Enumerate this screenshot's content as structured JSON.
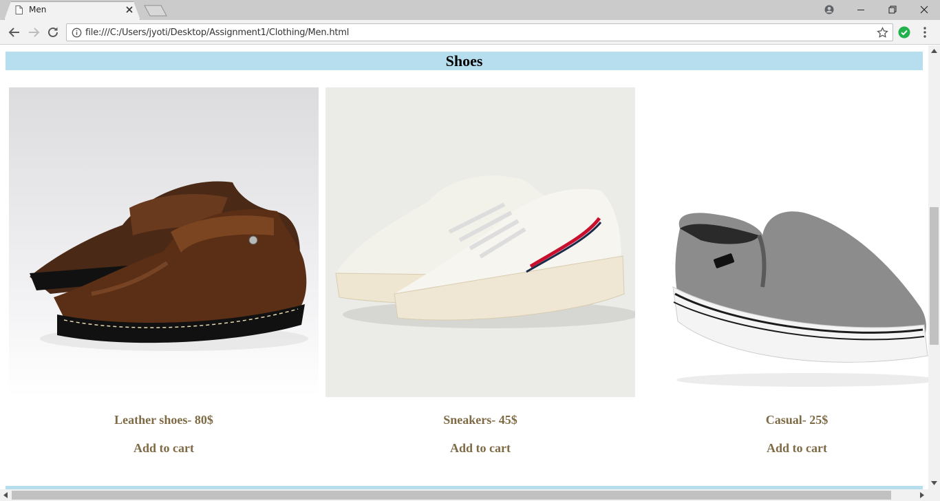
{
  "browser": {
    "tab_title": "Men",
    "url": "file:///C:/Users/jyoti/Desktop/Assignment1/Clothing/Men.html"
  },
  "page": {
    "section_title": "Shoes",
    "products": [
      {
        "name": "Leather shoes- 80$",
        "cart_label": "Add to cart",
        "image": "brown-leather-shoe"
      },
      {
        "name": "Sneakers- 45$",
        "cart_label": "Add to cart",
        "image": "white-sneaker"
      },
      {
        "name": "Casual- 25$",
        "cart_label": "Add to cart",
        "image": "grey-slip-on-shoe"
      }
    ]
  },
  "colors": {
    "header_band": "#b7deef",
    "product_text": "#7e6a45"
  }
}
